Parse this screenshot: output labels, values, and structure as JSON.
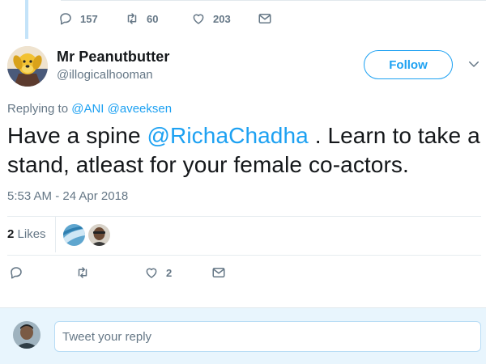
{
  "previous_tweet": {
    "actions": {
      "reply_count": "157",
      "retweet_count": "60",
      "like_count": "203"
    }
  },
  "tweet": {
    "author": {
      "name": "Mr Peanutbutter",
      "handle": "@illogicalhooman"
    },
    "follow_label": "Follow",
    "replying_to": {
      "prefix": "Replying to",
      "mentions": [
        "@ANI",
        "@aveeksen"
      ]
    },
    "text": {
      "part1": "Have a spine ",
      "mention": "@RichaChadha",
      "part2": " . Learn to take a stand, atleast for your female co-actors."
    },
    "timestamp": "5:53 AM - 24 Apr 2018",
    "likes": {
      "count": "2",
      "label": "Likes"
    },
    "actions": {
      "like_count": "2"
    }
  },
  "reply_box": {
    "placeholder": "Tweet your reply"
  },
  "icons": {
    "reply": "reply-icon",
    "retweet": "retweet-icon",
    "like": "heart-icon",
    "dm": "envelope-icon",
    "more": "chevron-down-icon"
  },
  "colors": {
    "accent": "#1da1f2",
    "muted": "#657786",
    "text": "#14171a",
    "reply_band": "#e8f5fd"
  }
}
